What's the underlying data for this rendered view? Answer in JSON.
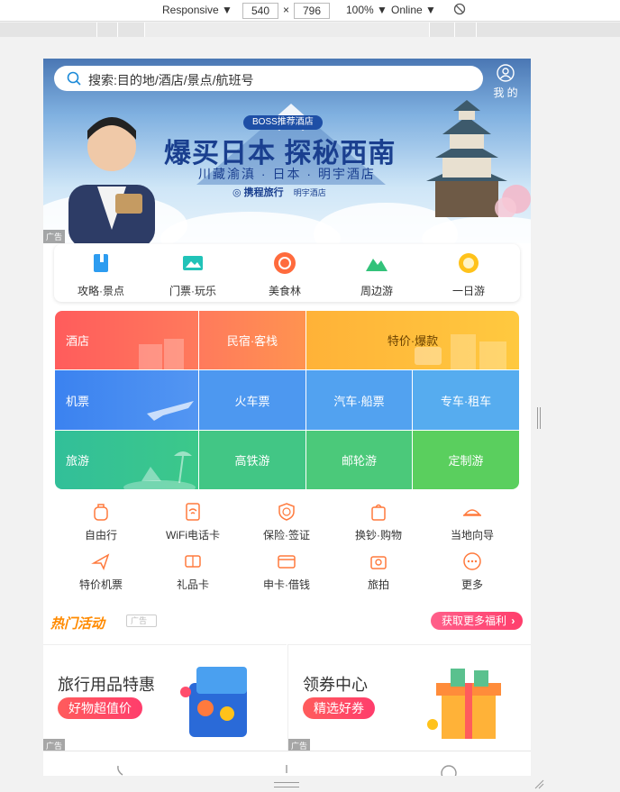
{
  "devtools": {
    "device": "Responsive",
    "width": "540",
    "height": "796",
    "zoom": "100%",
    "throttle": "Online",
    "times": "×"
  },
  "search": {
    "placeholder": "搜索:目的地/酒店/景点/航班号"
  },
  "mine_label": "我 的",
  "banner": {
    "badge": "BOSS推荐酒店",
    "headline": "爆买日本 探秘西南",
    "subline": "川藏渝滇 · 日本 · 明宇酒店",
    "brand": "携程旅行",
    "brand2": "明宇酒店",
    "ad": "广告"
  },
  "quick": [
    {
      "label": "攻略·景点",
      "icon": "book-icon"
    },
    {
      "label": "门票·玩乐",
      "icon": "ticket-icon"
    },
    {
      "label": "美食林",
      "icon": "food-icon"
    },
    {
      "label": "周边游",
      "icon": "mountain-icon"
    },
    {
      "label": "一日游",
      "icon": "sun-icon"
    }
  ],
  "grid": {
    "row1": [
      "酒店",
      "民宿·客栈",
      "特价·爆款"
    ],
    "row2": [
      "机票",
      "火车票",
      "汽车·船票",
      "专车·租车"
    ],
    "row3": [
      "旅游",
      "高铁游",
      "邮轮游",
      "定制游"
    ]
  },
  "services": [
    {
      "label": "自由行",
      "icon": "backpack-icon"
    },
    {
      "label": "WiFi电话卡",
      "icon": "wifi-card-icon"
    },
    {
      "label": "保险·签证",
      "icon": "shield-globe-icon"
    },
    {
      "label": "换钞·购物",
      "icon": "shopping-bag-icon"
    },
    {
      "label": "当地向导",
      "icon": "guide-hat-icon"
    },
    {
      "label": "特价机票",
      "icon": "plane-icon"
    },
    {
      "label": "礼品卡",
      "icon": "gift-card-icon"
    },
    {
      "label": "申卡·借钱",
      "icon": "credit-card-icon"
    },
    {
      "label": "旅拍",
      "icon": "camera-icon"
    },
    {
      "label": "更多",
      "icon": "more-icon"
    }
  ],
  "hot": {
    "title": "热门活动",
    "ad": "广告",
    "button": "获取更多福利"
  },
  "promos": [
    {
      "title": "旅行用品特惠",
      "button": "好物超值价",
      "ad": "广告"
    },
    {
      "title": "领券中心",
      "button": "精选好券",
      "ad": "广告"
    }
  ],
  "colors": {
    "hotel": "#ff6a5a",
    "flight": "#4c8ff0",
    "travel": "#39c089",
    "accent": "#ff8a00"
  }
}
